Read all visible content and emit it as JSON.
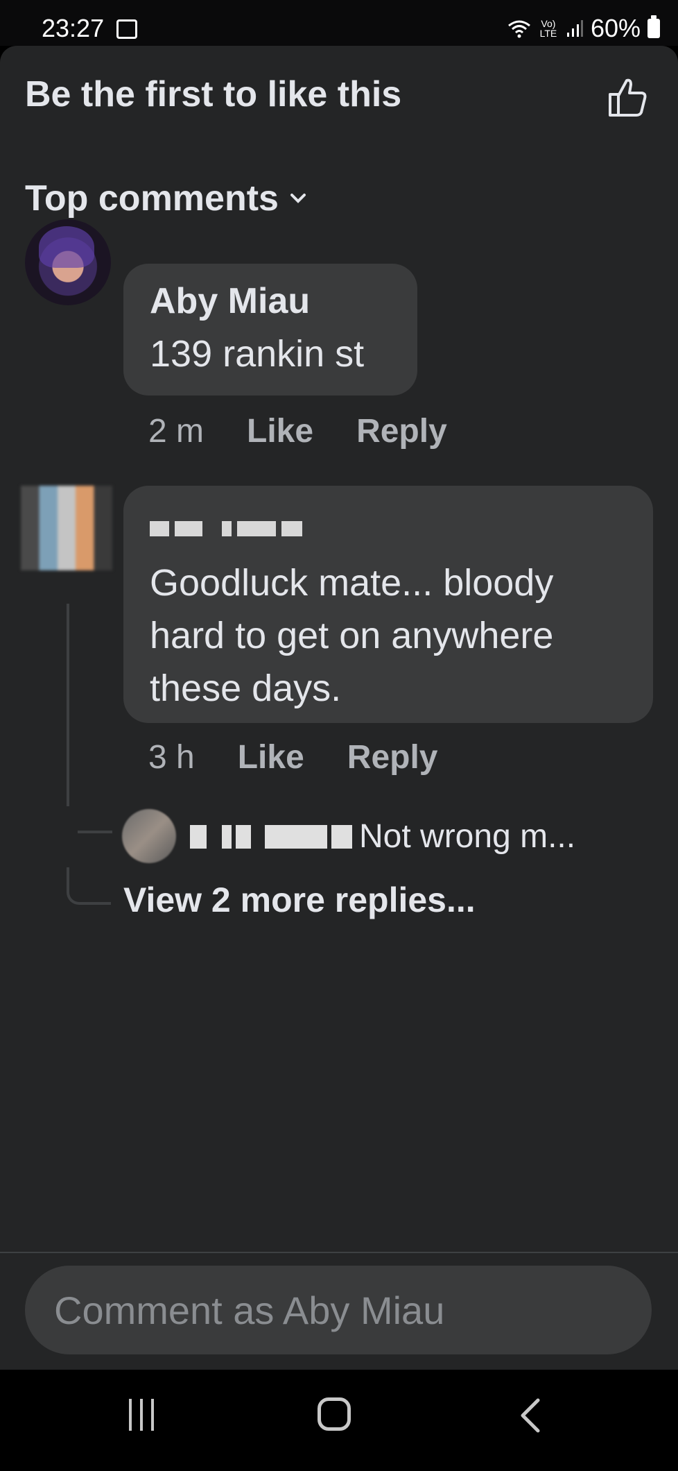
{
  "status_bar": {
    "time": "23:27",
    "network": "Vo) LTE",
    "battery": "60%"
  },
  "header": {
    "likes_text": "Be the first to like this",
    "like_icon": "thumbs-up-icon"
  },
  "sort": {
    "label": "Top comments",
    "icon": "chevron-down-icon"
  },
  "comments": [
    {
      "author": "Aby Miau",
      "text": "139 rankin st",
      "time": "2 m",
      "like_label": "Like",
      "reply_label": "Reply"
    },
    {
      "author": "",
      "author_redacted": true,
      "text": "Goodluck mate... bloody hard to get on anywhere these days.",
      "time": "3 h",
      "like_label": "Like",
      "reply_label": "Reply",
      "reply_preview": {
        "author_redacted": true,
        "text": "Not wrong m..."
      },
      "view_more": "View 2 more replies..."
    }
  ],
  "composer": {
    "placeholder": "Comment as Aby Miau"
  },
  "colors": {
    "sheet_bg": "#242526",
    "bubble_bg": "#3a3b3c",
    "meta_text": "#b0b3b8",
    "primary_text": "#e4e6eb"
  }
}
